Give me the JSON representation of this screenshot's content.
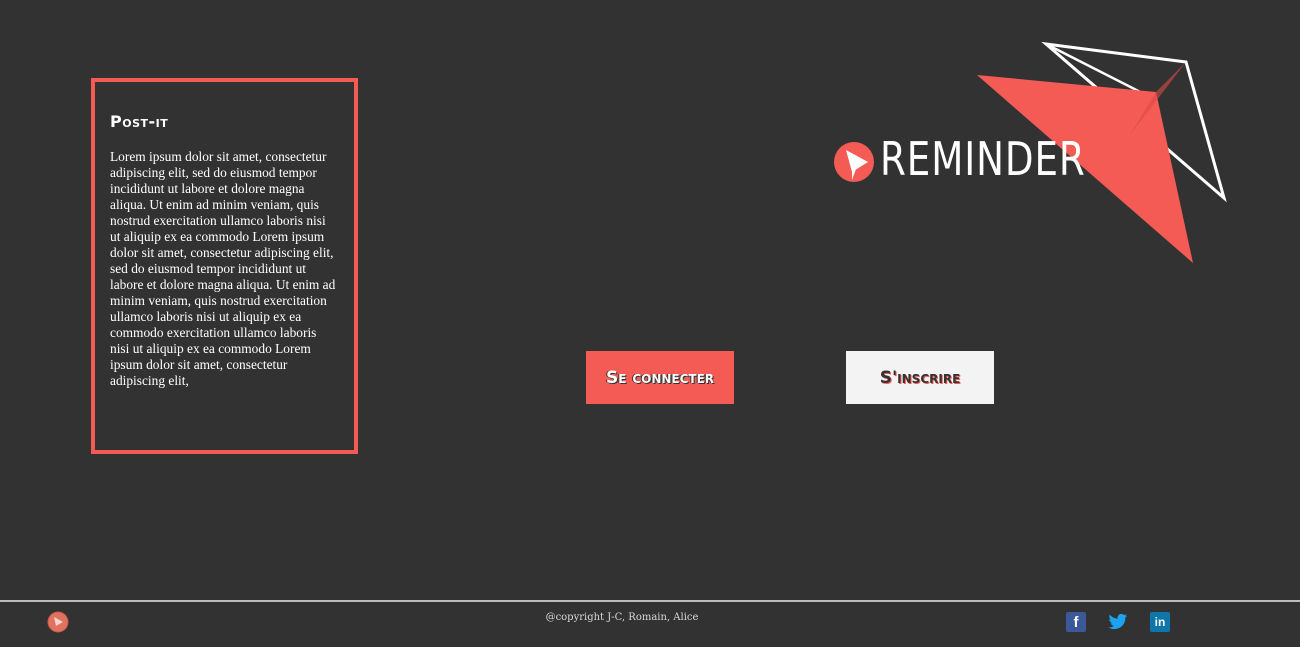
{
  "postit": {
    "title": "Post-it",
    "body": "Lorem ipsum dolor sit amet, consectetur adipiscing elit, sed do eiusmod tempor incididunt ut labore et dolore magna aliqua. Ut enim ad minim veniam, quis nostrud exercitation ullamco laboris nisi ut aliquip ex ea commodo Lorem ipsum dolor sit amet, consectetur adipiscing elit, sed do eiusmod tempor incididunt ut labore et dolore magna aliqua. Ut enim ad minim veniam, quis nostrud exercitation ullamco laboris nisi ut aliquip ex ea commodo exercitation ullamco laboris nisi ut aliquip ex ea commodo Lorem ipsum dolor sit amet, consectetur adipiscing elit,"
  },
  "logo": {
    "text": "REMINDER",
    "icon": "paper-plane-icon"
  },
  "buttons": {
    "login_label": "Se connecter",
    "signup_label": "S'inscrire"
  },
  "footer": {
    "copyright": "@copyright J-C, Romain, Alice",
    "social": [
      {
        "name": "facebook-icon",
        "glyph": "f"
      },
      {
        "name": "twitter-icon",
        "glyph": ""
      },
      {
        "name": "linkedin-icon",
        "glyph": "in"
      }
    ]
  },
  "colors": {
    "background": "#333232",
    "accent": "#f45b55",
    "text": "#ffffff"
  }
}
